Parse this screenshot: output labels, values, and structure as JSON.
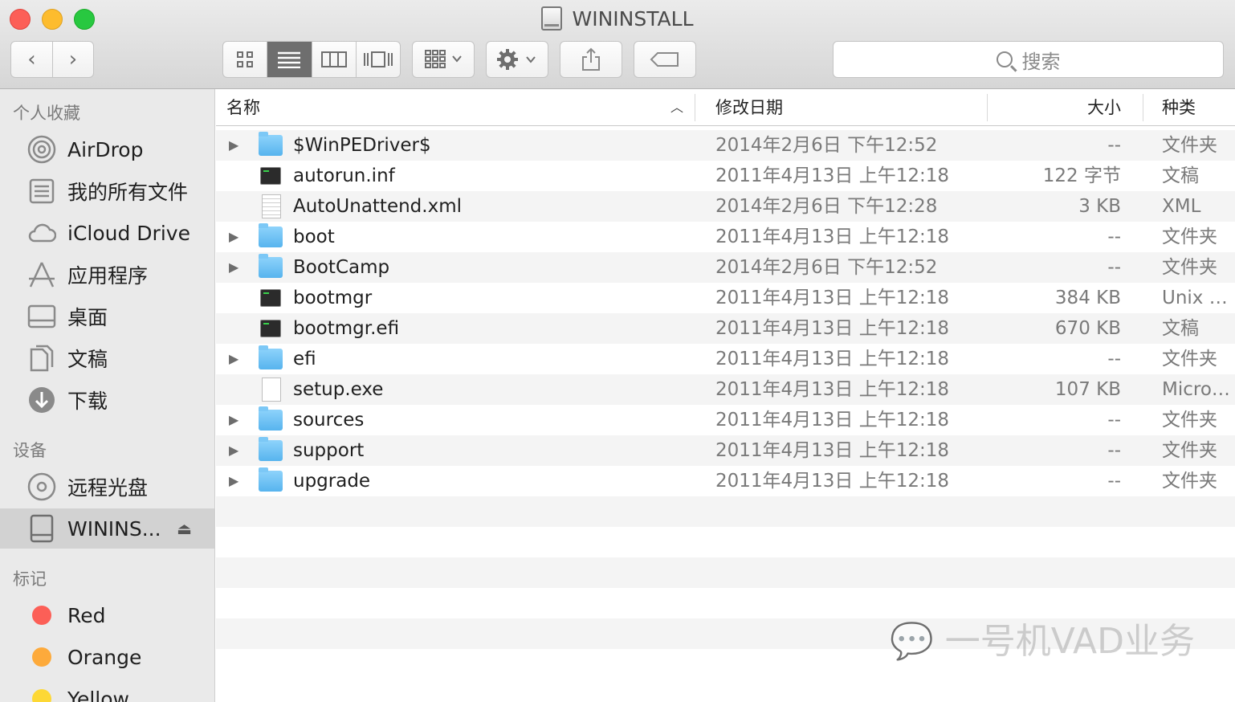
{
  "window": {
    "title": "WININSTALL"
  },
  "toolbar": {
    "back_glyph": "‹",
    "forward_glyph": "›",
    "search_placeholder": "搜索",
    "views": [
      "icon-view-icon",
      "list-view-icon",
      "column-view-icon",
      "coverflow-view-icon"
    ],
    "active_view": "list-view-icon"
  },
  "sidebar": {
    "favorites_title": "个人收藏",
    "favorites": [
      {
        "label": "AirDrop",
        "icon": "airdrop-icon"
      },
      {
        "label": "我的所有文件",
        "icon": "all-files-icon"
      },
      {
        "label": "iCloud Drive",
        "icon": "cloud-icon"
      },
      {
        "label": "应用程序",
        "icon": "applications-icon"
      },
      {
        "label": "桌面",
        "icon": "desktop-icon"
      },
      {
        "label": "文稿",
        "icon": "documents-icon"
      },
      {
        "label": "下载",
        "icon": "download-icon"
      }
    ],
    "devices_title": "设备",
    "devices": [
      {
        "label": "远程光盘",
        "icon": "disc-icon"
      },
      {
        "label": "WININS...",
        "icon": "drive-icon",
        "selected": true
      }
    ],
    "tags_title": "标记",
    "tags": [
      {
        "label": "Red",
        "color": "#fc5f57"
      },
      {
        "label": "Orange",
        "color": "#fdaa3b"
      },
      {
        "label": "Yellow",
        "color": "#fdd835"
      }
    ]
  },
  "columns": {
    "name": "名称",
    "date": "修改日期",
    "size": "大小",
    "kind": "种类"
  },
  "files": [
    {
      "name": "$WinPEDriver$",
      "date": "2014年2月6日 下午12:52",
      "size": "--",
      "kind": "文件夹",
      "type": "folder"
    },
    {
      "name": "autorun.inf",
      "date": "2011年4月13日 上午12:18",
      "size": "122 字节",
      "kind": "文稿",
      "type": "terminal"
    },
    {
      "name": "AutoUnattend.xml",
      "date": "2014年2月6日 下午12:28",
      "size": "3 KB",
      "kind": "XML",
      "type": "document-lines"
    },
    {
      "name": "boot",
      "date": "2011年4月13日 上午12:18",
      "size": "--",
      "kind": "文件夹",
      "type": "folder"
    },
    {
      "name": "BootCamp",
      "date": "2014年2月6日 下午12:52",
      "size": "--",
      "kind": "文件夹",
      "type": "folder"
    },
    {
      "name": "bootmgr",
      "date": "2011年4月13日 上午12:18",
      "size": "384 KB",
      "kind": "Unix e...",
      "type": "terminal"
    },
    {
      "name": "bootmgr.efi",
      "date": "2011年4月13日 上午12:18",
      "size": "670 KB",
      "kind": "文稿",
      "type": "terminal"
    },
    {
      "name": "efi",
      "date": "2011年4月13日 上午12:18",
      "size": "--",
      "kind": "文件夹",
      "type": "folder"
    },
    {
      "name": "setup.exe",
      "date": "2011年4月13日 上午12:18",
      "size": "107 KB",
      "kind": "Micros...",
      "type": "document"
    },
    {
      "name": "sources",
      "date": "2011年4月13日 上午12:18",
      "size": "--",
      "kind": "文件夹",
      "type": "folder"
    },
    {
      "name": "support",
      "date": "2011年4月13日 上午12:18",
      "size": "--",
      "kind": "文件夹",
      "type": "folder"
    },
    {
      "name": "upgrade",
      "date": "2011年4月13日 上午12:18",
      "size": "--",
      "kind": "文件夹",
      "type": "folder"
    }
  ],
  "empty_rows": 6,
  "watermark": "一号机VAD业务"
}
